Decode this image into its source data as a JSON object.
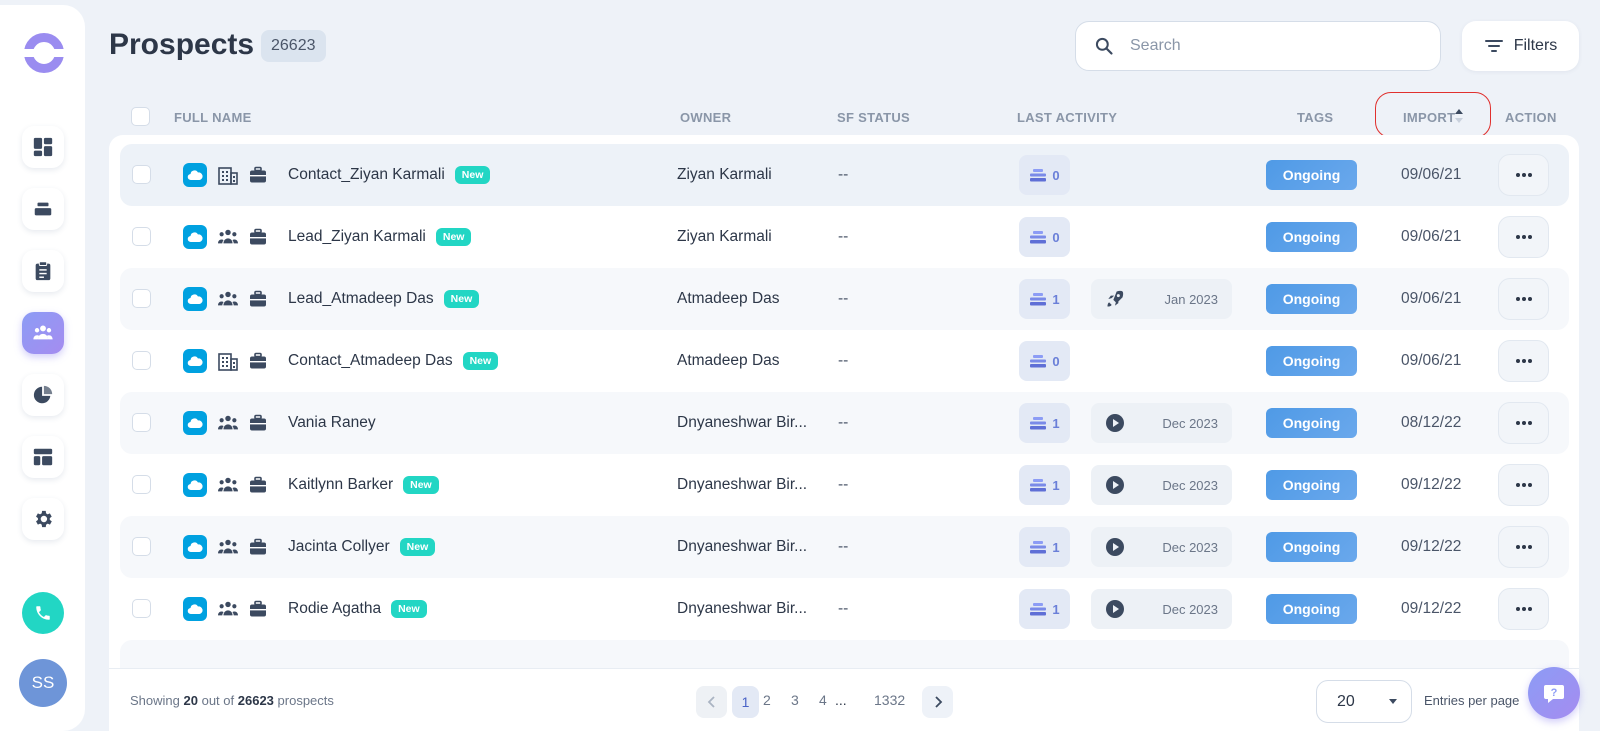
{
  "header": {
    "title": "Prospects",
    "count": "26623",
    "search_placeholder": "Search",
    "filters_label": "Filters"
  },
  "sidebar": {
    "items": [
      {
        "icon": "dashboard-icon",
        "active": false
      },
      {
        "icon": "stack-icon",
        "active": false
      },
      {
        "icon": "clipboard-icon",
        "active": false
      },
      {
        "icon": "people-icon",
        "active": true
      },
      {
        "icon": "pie-chart-icon",
        "active": false
      },
      {
        "icon": "layout-icon",
        "active": false
      },
      {
        "icon": "gear-icon",
        "active": false
      }
    ],
    "avatar_initials": "SS"
  },
  "table": {
    "columns": [
      "FULL NAME",
      "OWNER",
      "SF STATUS",
      "LAST ACTIVITY",
      "TAGS",
      "IMPORT",
      "ACTION"
    ],
    "rows": [
      {
        "name": "Contact_Ziyan Karmali",
        "new": "New",
        "type": "building",
        "owner": "Ziyan Karmali",
        "sf_status": "--",
        "activity_count": "0",
        "activity_icon": null,
        "activity_date": null,
        "tag": "Ongoing",
        "import": "09/06/21"
      },
      {
        "name": "Lead_Ziyan Karmali",
        "new": "New",
        "type": "people",
        "owner": "Ziyan Karmali",
        "sf_status": "--",
        "activity_count": "0",
        "activity_icon": null,
        "activity_date": null,
        "tag": "Ongoing",
        "import": "09/06/21"
      },
      {
        "name": "Lead_Atmadeep Das",
        "new": "New",
        "type": "people",
        "owner": "Atmadeep Das",
        "sf_status": "--",
        "activity_count": "1",
        "activity_icon": "rocket-icon",
        "activity_date": "Jan 2023",
        "tag": "Ongoing",
        "import": "09/06/21"
      },
      {
        "name": "Contact_Atmadeep Das",
        "new": "New",
        "type": "building",
        "owner": "Atmadeep Das",
        "sf_status": "--",
        "activity_count": "0",
        "activity_icon": null,
        "activity_date": null,
        "tag": "Ongoing",
        "import": "09/06/21"
      },
      {
        "name": "Vania Raney",
        "new": null,
        "type": "people",
        "owner": "Dnyaneshwar Bir...",
        "sf_status": "--",
        "activity_count": "1",
        "activity_icon": "play-icon",
        "activity_date": "Dec 2023",
        "tag": "Ongoing",
        "import": "08/12/22"
      },
      {
        "name": "Kaitlynn Barker",
        "new": "New",
        "type": "people",
        "owner": "Dnyaneshwar Bir...",
        "sf_status": "--",
        "activity_count": "1",
        "activity_icon": "play-icon",
        "activity_date": "Dec 2023",
        "tag": "Ongoing",
        "import": "09/12/22"
      },
      {
        "name": "Jacinta Collyer",
        "new": "New",
        "type": "people",
        "owner": "Dnyaneshwar Bir...",
        "sf_status": "--",
        "activity_count": "1",
        "activity_icon": "play-icon",
        "activity_date": "Dec 2023",
        "tag": "Ongoing",
        "import": "09/12/22"
      },
      {
        "name": "Rodie Agatha",
        "new": "New",
        "type": "people",
        "owner": "Dnyaneshwar Bir...",
        "sf_status": "--",
        "activity_count": "1",
        "activity_icon": "play-icon",
        "activity_date": "Dec 2023",
        "tag": "Ongoing",
        "import": "09/12/22"
      }
    ]
  },
  "footer": {
    "showing_prefix": "Showing",
    "showing_count": "20",
    "showing_middle": "out of",
    "showing_total": "26623",
    "showing_suffix": "prospects",
    "pages": [
      "1",
      "2",
      "3",
      "4"
    ],
    "ellipsis": "...",
    "last_page": "1332",
    "current_page": "1",
    "per_page": "20",
    "per_page_label": "Entries per page"
  },
  "colors": {
    "accent": "#8c9cf5",
    "salesforce": "#00a1e0",
    "new_badge": "#22d6c4",
    "tag": "#4f9ae6",
    "highlight_ring": "#e0302e"
  }
}
